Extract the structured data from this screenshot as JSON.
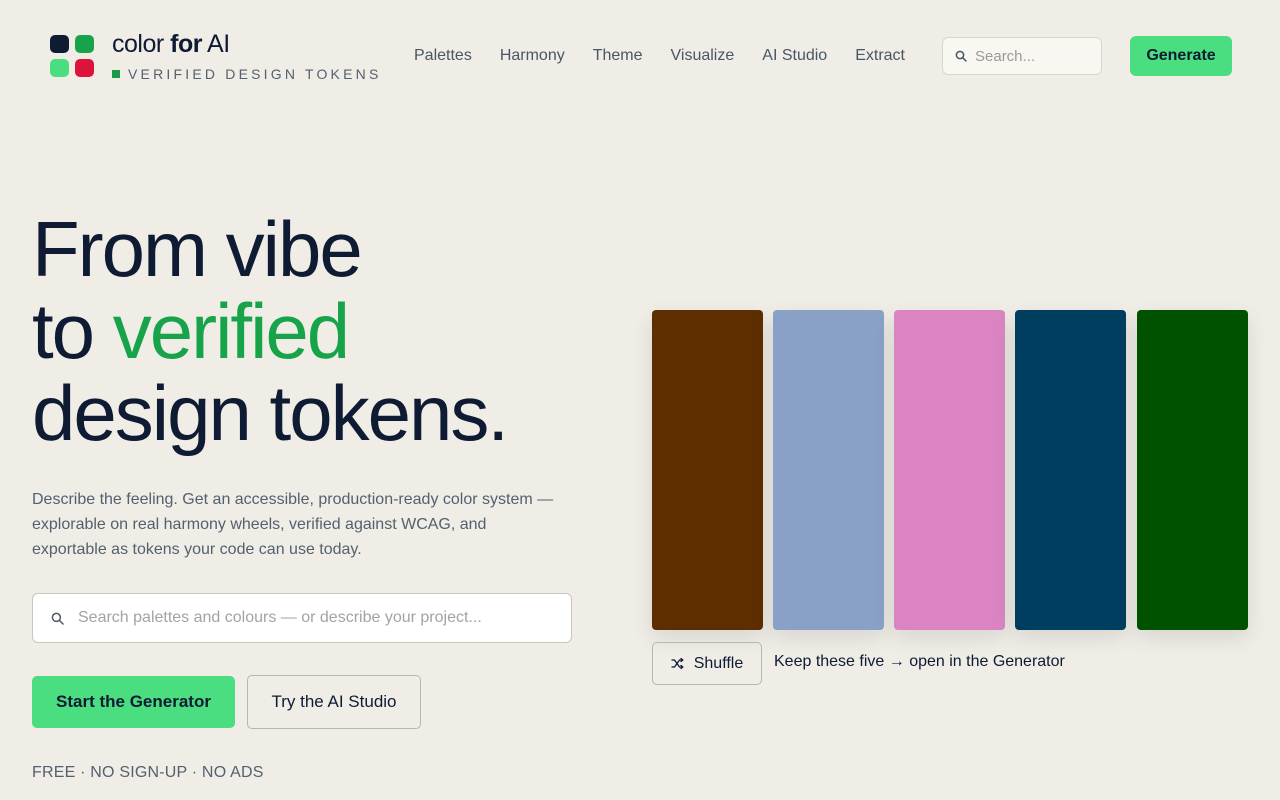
{
  "brand": {
    "name_part1": "color ",
    "name_part2": "for",
    "name_part3": " AI",
    "tagline": "VERIFIED DESIGN TOKENS",
    "logo_colors": [
      "#0f1b33",
      "#16a34a",
      "#4ade80",
      "#dc143c"
    ]
  },
  "nav": {
    "items": [
      {
        "label": "Palettes"
      },
      {
        "label": "Harmony"
      },
      {
        "label": "Theme"
      },
      {
        "label": "Visualize"
      },
      {
        "label": "AI Studio"
      },
      {
        "label": "Extract"
      }
    ]
  },
  "header_search": {
    "placeholder": "Search..."
  },
  "header_cta": {
    "label": "Generate"
  },
  "hero": {
    "line1": "From vibe",
    "line2_prefix": "to ",
    "line2_accent": "verified",
    "line3": "design tokens.",
    "description": "Describe the feeling. Get an accessible, production-ready color system — explorable on real harmony wheels, verified against WCAG, and exportable as tokens your code can use today."
  },
  "main_search": {
    "placeholder": "Search palettes and colours — or describe your project..."
  },
  "cta": {
    "primary": "Start the Generator",
    "secondary": "Try the AI Studio"
  },
  "footnote": "FREE · NO SIGN-UP · NO ADS",
  "palette": {
    "colors": [
      "#5c2e00",
      "#89a1c6",
      "#da85c1",
      "#003e5f",
      "#005200"
    ],
    "shuffle_label": "Shuffle",
    "keep_label": "Keep these five → open in the Generator"
  },
  "theme": {
    "accent": "#4ade80",
    "accent_text": "#16a34a",
    "background": "#efede6",
    "ink": "#0f1b33"
  }
}
